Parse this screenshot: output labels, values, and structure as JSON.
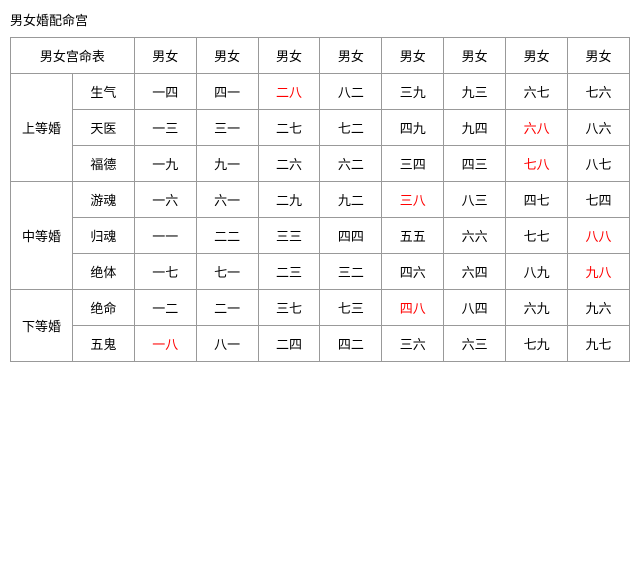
{
  "title": "男女婚配命宫",
  "table": {
    "col_headers": [
      "男女宫命表",
      "",
      "男女",
      "男女",
      "男女",
      "男女",
      "男女",
      "男女",
      "男女",
      "男女"
    ],
    "rows": [
      {
        "group": "上等婚",
        "items": [
          {
            "sub": "生气",
            "cols": [
              "一四",
              "四一",
              "二八",
              "八二",
              "三九",
              "九三",
              "六七",
              "七六"
            ],
            "red": [
              2
            ]
          },
          {
            "sub": "天医",
            "cols": [
              "一三",
              "三一",
              "二七",
              "七二",
              "四九",
              "九四",
              "六八",
              "八六"
            ],
            "red": [
              6
            ]
          },
          {
            "sub": "福德",
            "cols": [
              "一九",
              "九一",
              "二六",
              "六二",
              "三四",
              "四三",
              "七八",
              "八七"
            ],
            "red": [
              6
            ]
          }
        ]
      },
      {
        "group": "中等婚",
        "items": [
          {
            "sub": "游魂",
            "cols": [
              "一六",
              "六一",
              "二九",
              "九二",
              "三八",
              "八三",
              "四七",
              "七四"
            ],
            "red": [
              4
            ]
          },
          {
            "sub": "归魂",
            "cols": [
              "一一",
              "二二",
              "三三",
              "四四",
              "五五",
              "六六",
              "七七",
              "八八"
            ],
            "red": [
              7
            ]
          },
          {
            "sub": "绝体",
            "cols": [
              "一七",
              "七一",
              "二三",
              "三二",
              "四六",
              "六四",
              "八九",
              "九八"
            ],
            "red": [
              7
            ]
          }
        ]
      },
      {
        "group": "下等婚",
        "items": [
          {
            "sub": "绝命",
            "cols": [
              "一二",
              "二一",
              "三七",
              "七三",
              "四八",
              "八四",
              "六九",
              "九六"
            ],
            "red": [
              4
            ]
          },
          {
            "sub": "五鬼",
            "cols": [
              "一八",
              "八一",
              "二四",
              "四二",
              "三六",
              "六三",
              "七九",
              "九七"
            ],
            "red": [
              0
            ]
          }
        ]
      }
    ]
  }
}
